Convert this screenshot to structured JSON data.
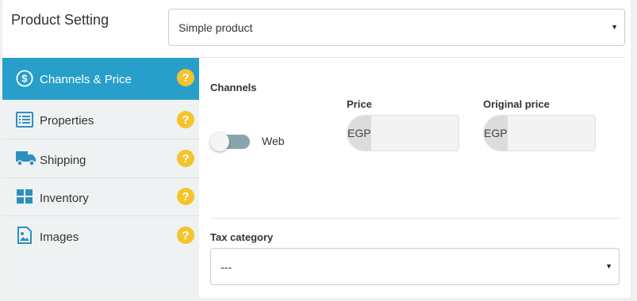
{
  "header": {
    "title": "Product Setting",
    "product_type": {
      "selected": "Simple product",
      "caret": "▼"
    }
  },
  "sidebar": {
    "items": [
      {
        "label": "Channels & Price",
        "icon": "dollar-circle-icon",
        "active": true,
        "help": "?"
      },
      {
        "label": "Properties",
        "icon": "list-icon",
        "active": false,
        "help": "?"
      },
      {
        "label": "Shipping",
        "icon": "truck-icon",
        "active": false,
        "help": "?"
      },
      {
        "label": "Inventory",
        "icon": "grid-icon",
        "active": false,
        "help": "?"
      },
      {
        "label": "Images",
        "icon": "image-file-icon",
        "active": false,
        "help": "?"
      }
    ]
  },
  "channels": {
    "heading": "Channels",
    "web_label": "Web",
    "web_enabled": false,
    "price_label": "Price",
    "price_currency": "EGP",
    "price_value": "",
    "original_price_label": "Original price",
    "original_price_currency": "EGP",
    "original_price_value": ""
  },
  "tax": {
    "label": "Tax category",
    "selected": "---",
    "caret": "▼"
  },
  "colors": {
    "accent": "#279fca",
    "help": "#f5c32c",
    "sidebar_bg": "#eff2f3",
    "toggle_track": "#8aa4ad"
  }
}
